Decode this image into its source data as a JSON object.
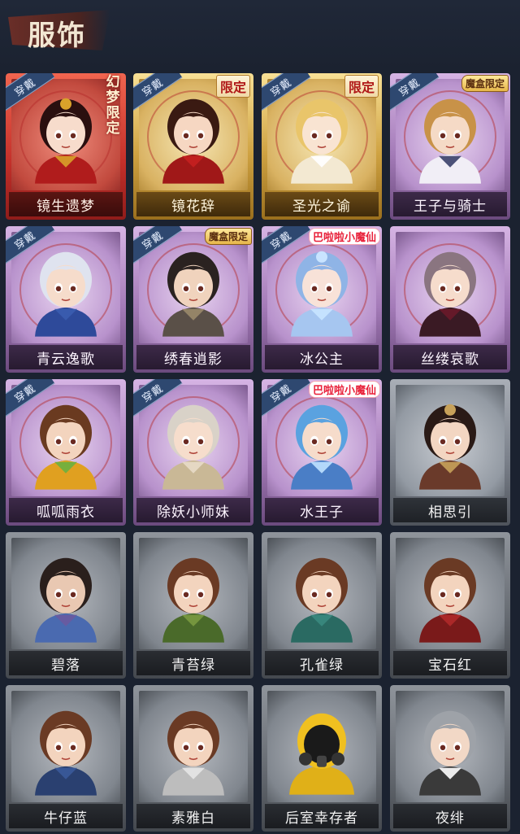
{
  "header": {
    "title": "服饰"
  },
  "badges": {
    "worn": "穿戴"
  },
  "tags": {
    "limited": "限定",
    "box_limited": "魔盒限定",
    "dream_limited": "幻梦限定",
    "collab": "巴啦啦小魔仙"
  },
  "colors": {
    "background": "#1b2230",
    "title": "#f2e6d2",
    "worn_badge": "#2e4870",
    "limited_text": "#b01818"
  },
  "costumes": [
    {
      "name": "镜生遗梦",
      "frame": "red",
      "worn": true,
      "tag": "dream_limited",
      "avatar": "crowned-bride"
    },
    {
      "name": "镜花辞",
      "frame": "gold",
      "worn": true,
      "tag": "limited",
      "avatar": "red-veil-lady"
    },
    {
      "name": "圣光之谕",
      "frame": "gold",
      "worn": true,
      "tag": "limited",
      "avatar": "golden-curls"
    },
    {
      "name": "王子与骑士",
      "frame": "purple",
      "worn": true,
      "tag": "box_limited",
      "avatar": "prince-cap"
    },
    {
      "name": "青云逸歌",
      "frame": "purple",
      "worn": true,
      "tag": "",
      "avatar": "silver-hair-boy"
    },
    {
      "name": "绣春逍影",
      "frame": "purple",
      "worn": true,
      "tag": "box_limited",
      "avatar": "swordsman"
    },
    {
      "name": "冰公主",
      "frame": "purple",
      "worn": true,
      "tag": "collab",
      "avatar": "ice-princess"
    },
    {
      "name": "丝缕哀歌",
      "frame": "purple",
      "worn": false,
      "tag": "",
      "avatar": "gothic-doll"
    },
    {
      "name": "呱呱雨衣",
      "frame": "purple",
      "worn": true,
      "tag": "",
      "avatar": "frog-hat-girl"
    },
    {
      "name": "除妖小师妹",
      "frame": "purple",
      "worn": true,
      "tag": "",
      "avatar": "blindfold-girl"
    },
    {
      "name": "水王子",
      "frame": "purple",
      "worn": true,
      "tag": "collab",
      "avatar": "water-prince"
    },
    {
      "name": "相思引",
      "frame": "grey",
      "worn": false,
      "tag": "",
      "avatar": "headpiece-girl"
    },
    {
      "name": "碧落",
      "frame": "grey-dark",
      "worn": false,
      "tag": "",
      "avatar": "braid-boy"
    },
    {
      "name": "青苔绿",
      "frame": "grey-dark",
      "worn": false,
      "tag": "",
      "avatar": "girl-green"
    },
    {
      "name": "孔雀绿",
      "frame": "grey-dark",
      "worn": false,
      "tag": "",
      "avatar": "girl-teal"
    },
    {
      "name": "宝石红",
      "frame": "grey-dark",
      "worn": false,
      "tag": "",
      "avatar": "girl-red"
    },
    {
      "name": "牛仔蓝",
      "frame": "grey-dark",
      "worn": false,
      "tag": "",
      "avatar": "girl-blue"
    },
    {
      "name": "素雅白",
      "frame": "grey-dark",
      "worn": false,
      "tag": "",
      "avatar": "girl-white"
    },
    {
      "name": "后室幸存者",
      "frame": "grey-dark",
      "worn": false,
      "tag": "",
      "avatar": "gas-mask-suit"
    },
    {
      "name": "夜绯",
      "frame": "grey-dark",
      "worn": false,
      "tag": "",
      "avatar": "grey-hair-boy"
    }
  ]
}
